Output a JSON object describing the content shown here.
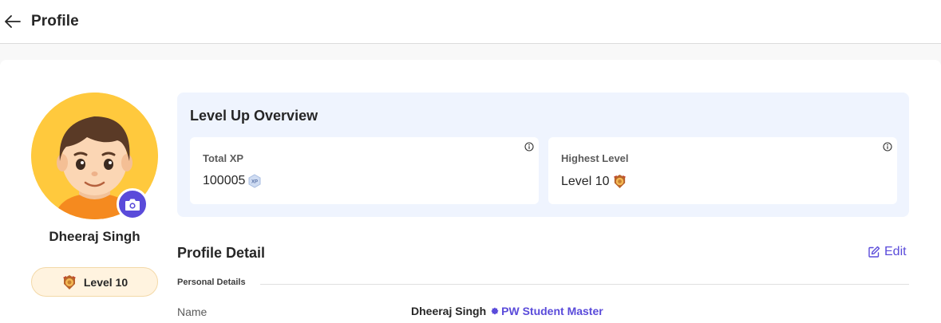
{
  "header": {
    "title": "Profile",
    "back_icon": "arrow-left-icon"
  },
  "profile": {
    "name": "Dheeraj Singh",
    "level_label": "Level 10",
    "camera_icon": "camera-icon"
  },
  "overview": {
    "title": "Level Up Overview",
    "total_xp": {
      "label": "Total XP",
      "value": "100005",
      "badge_text": "XP"
    },
    "highest_level": {
      "label": "Highest Level",
      "value": "Level 10"
    }
  },
  "details": {
    "title": "Profile Detail",
    "edit_label": "Edit",
    "section_label": "Personal Details",
    "fields": [
      {
        "label": "Name",
        "value": "Dheeraj Singh",
        "tag": "PW Student Master"
      }
    ]
  },
  "colors": {
    "accent": "#5a4bda",
    "overview_bg": "#eff4fe",
    "avatar_bg": "#ffc93d",
    "level_pill_bg": "#fff3df"
  }
}
